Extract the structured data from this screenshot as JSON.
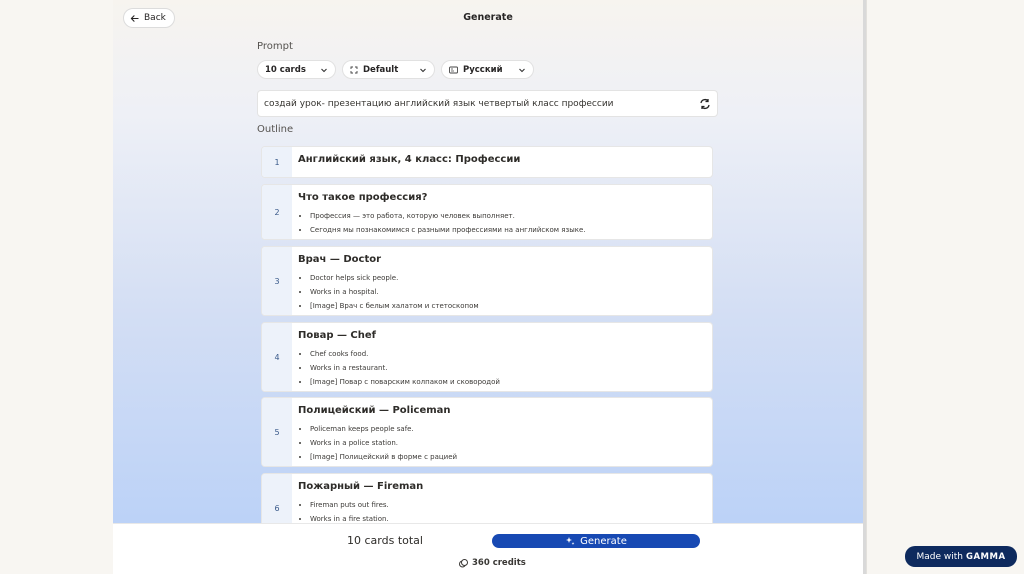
{
  "header": {
    "back_label": "Back",
    "title": "Generate"
  },
  "prompt": {
    "section_label": "Prompt",
    "cards_select": "10 cards",
    "theme_select": "Default",
    "language_select": "Русский",
    "text": "создай урок- презентацию английский язык четвертый класс профессии"
  },
  "outline": {
    "section_label": "Outline",
    "cards": [
      {
        "num": "1",
        "title": "Английский язык, 4 класс: Профессии",
        "bullets": []
      },
      {
        "num": "2",
        "title": "Что такое профессия?",
        "bullets": [
          "Профессия — это работа, которую человек выполняет.",
          "Сегодня мы познакомимся с разными профессиями на английском языке."
        ]
      },
      {
        "num": "3",
        "title": "Врач — Doctor",
        "bullets": [
          "Doctor helps sick people.",
          "Works in a hospital.",
          "[Image] Врач с белым халатом и стетоскопом"
        ]
      },
      {
        "num": "4",
        "title": "Повар — Chef",
        "bullets": [
          "Chef cooks food.",
          "Works in a restaurant.",
          "[Image] Повар с поварским колпаком и сковородой"
        ]
      },
      {
        "num": "5",
        "title": "Полицейский — Policeman",
        "bullets": [
          "Policeman keeps people safe.",
          "Works in a police station.",
          "[Image] Полицейский в форме с рацией"
        ]
      },
      {
        "num": "6",
        "title": "Пожарный — Fireman",
        "bullets": [
          "Fireman puts out fires.",
          "Works in a fire station."
        ]
      }
    ]
  },
  "footer": {
    "total_label": "10 cards total",
    "generate_label": "Generate",
    "credits_label": "360 credits"
  },
  "badge": {
    "made_with": "Made with",
    "brand": "GAMMA"
  },
  "colors": {
    "accent": "#1749b3",
    "badge_bg": "#0e2a5e"
  }
}
